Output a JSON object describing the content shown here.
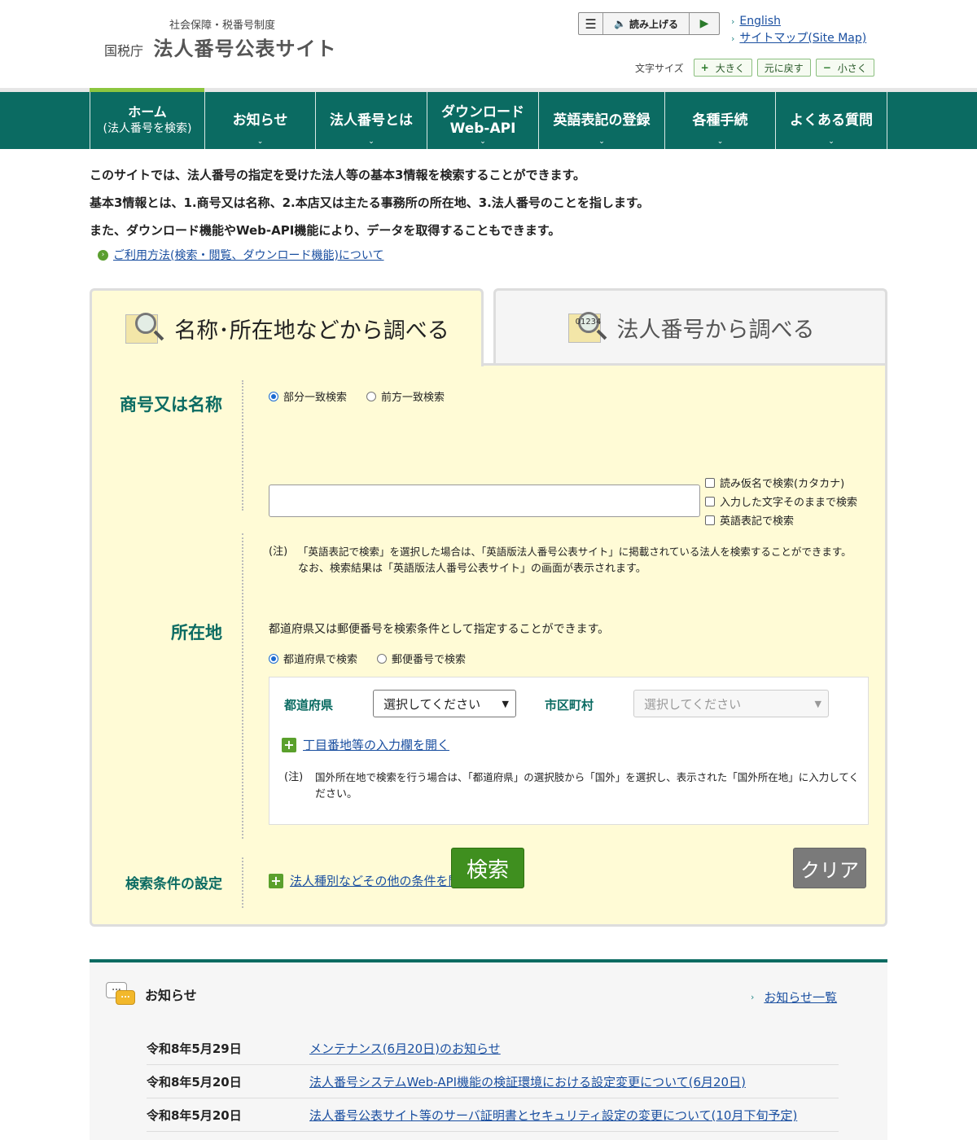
{
  "header": {
    "subtitle": "社会保障・税番号制度",
    "agency": "国税庁",
    "title": "法人番号公表サイト",
    "readaloud": {
      "menu_icon": "menu-icon",
      "label": "読み上げる",
      "speaker_icon": "speaker-icon",
      "play_icon": "play-icon"
    },
    "lang_link": "English",
    "sitemap_link": "サイトマップ(Site Map)",
    "fontsize": {
      "label": "文字サイズ",
      "larger": "大きく",
      "reset": "元に戻す",
      "smaller": "小さく"
    }
  },
  "nav": [
    {
      "l1": "ホーム",
      "l2": "(法人番号を検索)"
    },
    {
      "l1": "お知らせ",
      "l2": ""
    },
    {
      "l1": "法人番号とは",
      "l2": ""
    },
    {
      "l1": "ダウンロード",
      "l2": "Web-API"
    },
    {
      "l1": "英語表記の登録",
      "l2": ""
    },
    {
      "l1": "各種手続",
      "l2": ""
    },
    {
      "l1": "よくある質問",
      "l2": ""
    }
  ],
  "intro": {
    "line1": "このサイトでは、法人番号の指定を受けた法人等の基本3情報を検索することができます。",
    "line2": "基本3情報とは、1.商号又は名称、2.本店又は主たる事務所の所在地、3.法人番号のことを指します。",
    "line3": "また、ダウンロード機能やWeb-API機能により、データを取得することもできます。",
    "usage_link": "ご利用方法(検索・閲覧、ダウンロード機能)について"
  },
  "tabs": {
    "by_name": "名称･所在地などから調べる",
    "by_number": "法人番号から調べる",
    "number_icon_text": "01234"
  },
  "name_section": {
    "label": "商号又は名称",
    "radio_partial": "部分一致検索",
    "radio_prefix": "前方一致検索",
    "check_kana": "読み仮名で検索(カタカナ)",
    "check_literal": "入力した文字そのままで検索",
    "check_english": "英語表記で検索",
    "note_mark": "(注)",
    "note_line1": "「英語表記で検索」を選択した場合は、「英語版法人番号公表サイト」に掲載されている法人を検索することができます。",
    "note_line2": "なお、検索結果は「英語版法人番号公表サイト」の画面が表示されます。"
  },
  "address_section": {
    "label": "所在地",
    "desc": "都道府県又は郵便番号を検索条件として指定することができます。",
    "radio_pref": "都道府県で検索",
    "radio_zip": "郵便番号で検索",
    "pref_label": "都道府県",
    "pref_value": "選択してください",
    "city_label": "市区町村",
    "city_value": "選択してください",
    "open_detail": "丁目番地等の入力欄を開く",
    "note_mark": "(注)",
    "note_line1": "国外所在地で検索を行う場合は、「都道府県」の選択肢から「国外」を選択し、表示された「国外所在地」に入力してく",
    "note_line2": "ださい。"
  },
  "condition_section": {
    "label": "検索条件の設定",
    "open_link": "法人種別などその他の条件を開く"
  },
  "buttons": {
    "search": "検索",
    "clear": "クリア"
  },
  "news": {
    "title": "お知らせ",
    "all_link": "お知らせ一覧",
    "items": [
      {
        "date": "令和8年5月29日",
        "title": "メンテナンス(6月20日)のお知らせ"
      },
      {
        "date": "令和8年5月20日",
        "title": "法人番号システムWeb-API機能の検証環境における設定変更について(6月20日)"
      },
      {
        "date": "令和8年5月20日",
        "title": "法人番号公表サイト等のサーバ証明書とセキュリティ設定の変更について(10月下旬予定)"
      }
    ]
  },
  "colors": {
    "primary": "#0b6b62",
    "accent": "#8cc63f",
    "panel": "#fffbd6",
    "link": "#1a4fa0",
    "search_button": "#3f8f1f"
  }
}
